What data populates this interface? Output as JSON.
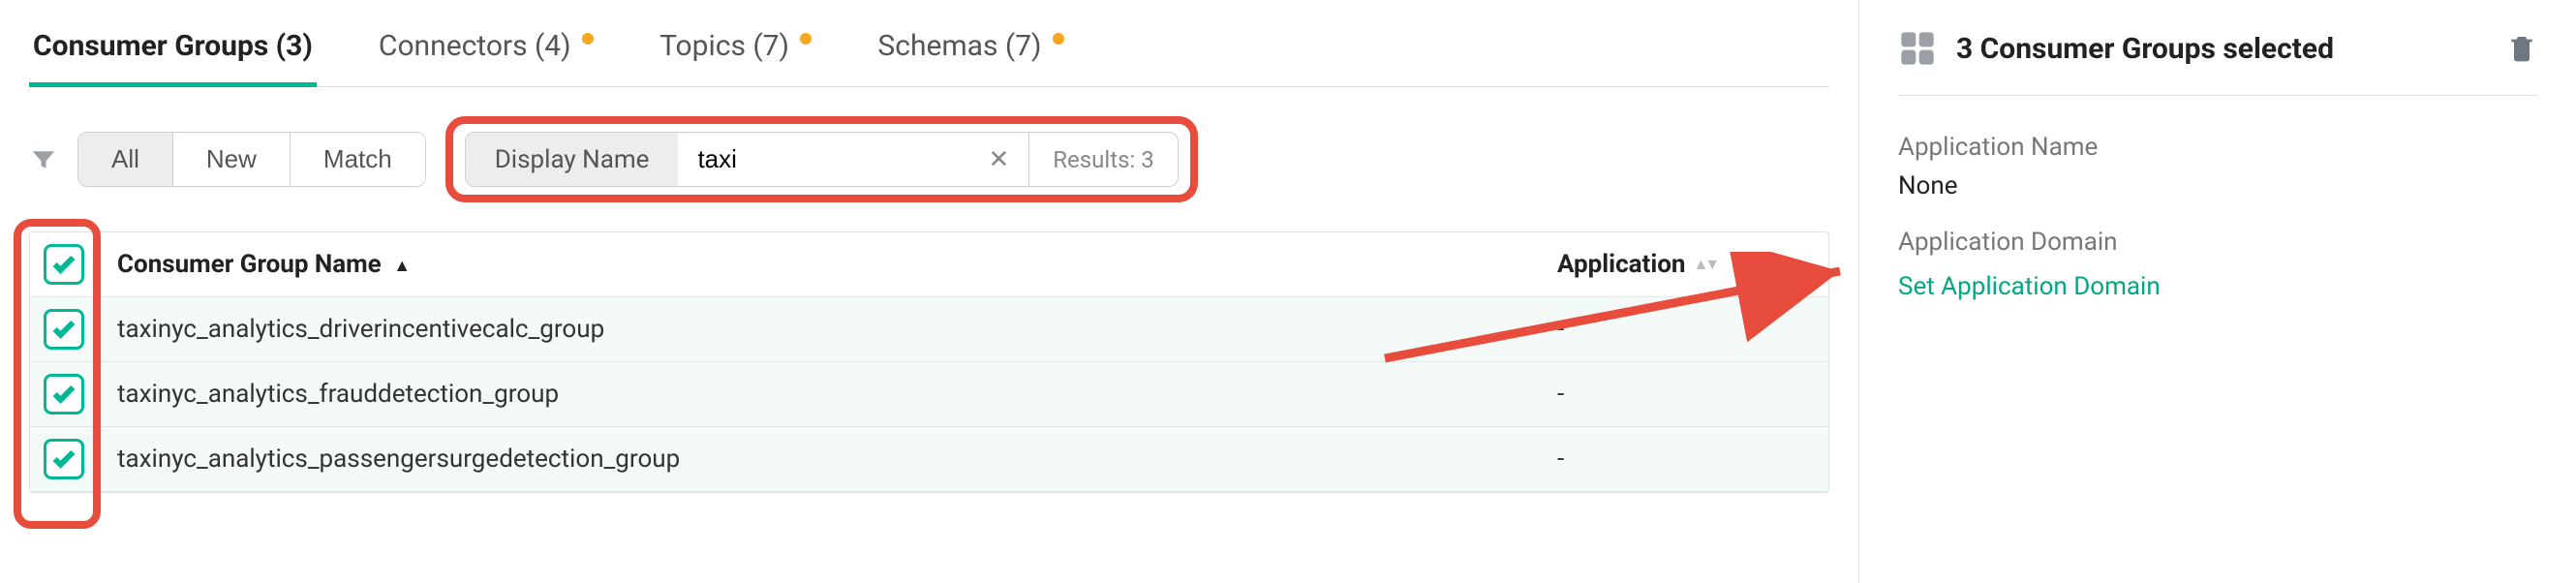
{
  "tabs": [
    {
      "label": "Consumer Groups (3)",
      "active": true,
      "dot": false
    },
    {
      "label": "Connectors (4)",
      "active": false,
      "dot": true
    },
    {
      "label": "Topics (7)",
      "active": false,
      "dot": true
    },
    {
      "label": "Schemas (7)",
      "active": false,
      "dot": true
    }
  ],
  "filter": {
    "segments": [
      "All",
      "New",
      "Match"
    ],
    "active_segment": "All",
    "search_label": "Display Name",
    "search_value": "taxi",
    "results_label": "Results: 3"
  },
  "table": {
    "col_name_header": "Consumer Group Name",
    "col_app_header": "Application",
    "rows": [
      {
        "name": "taxinyc_analytics_driverincentivecalc_group",
        "app": "-",
        "checked": true
      },
      {
        "name": "taxinyc_analytics_frauddetection_group",
        "app": "-",
        "checked": true
      },
      {
        "name": "taxinyc_analytics_passengersurgedetection_group",
        "app": "-",
        "checked": true
      }
    ]
  },
  "side": {
    "title": "3 Consumer Groups selected",
    "app_name_label": "Application Name",
    "app_name_value": "None",
    "domain_label": "Application Domain",
    "domain_link": "Set Application Domain"
  }
}
